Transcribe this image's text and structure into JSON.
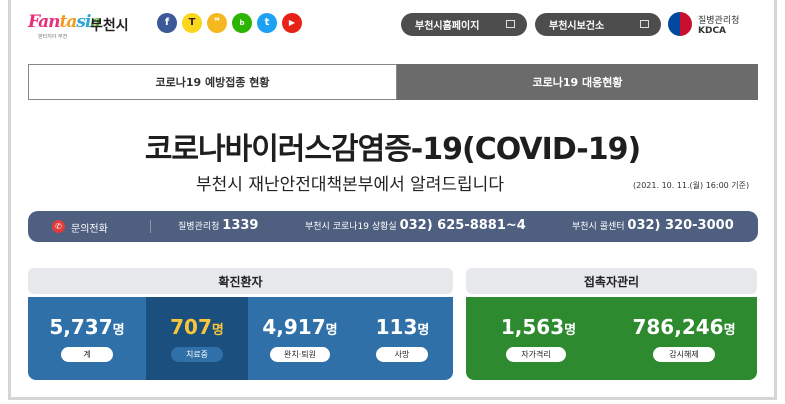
{
  "header": {
    "logo_text": "Fantasia",
    "logo_sub": "판타지아 부천",
    "city_name": "부천시",
    "sns_icons": [
      "facebook-icon",
      "kakaotalk-icon",
      "kakaostory-icon",
      "blog-icon",
      "twitter-icon",
      "youtube-icon"
    ],
    "buttons": {
      "homepage": "부천시홈페이지",
      "health_center": "부천시보건소"
    },
    "kdca": {
      "name_ko": "질병관리청",
      "name_en": "KDCA"
    }
  },
  "tabs": [
    {
      "label": "코로나19 예방접종 현황",
      "active": false
    },
    {
      "label": "코로나19 대응현황",
      "active": true
    }
  ],
  "title": "코로나바이러스감염증-19(COVID-19)",
  "subtitle": "부천시 재난안전대책본부에서 알려드립니다",
  "date": "(2021. 10. 11.(월) 16:00 기준)",
  "contact": {
    "label": "문의전화",
    "items": [
      {
        "name": "질병관리청",
        "number": "1339"
      },
      {
        "name": "부천시 코로나19 상황실",
        "number": "032) 625-8881~4"
      },
      {
        "name": "부천시 콜센터",
        "number": "032) 320-3000"
      }
    ]
  },
  "confirmed": {
    "heading": "확진환자",
    "unit": "명",
    "stats": [
      {
        "value": "5,737",
        "label": "계"
      },
      {
        "value": "707",
        "label": "치료중"
      },
      {
        "value": "4,917",
        "label": "완치·퇴원"
      },
      {
        "value": "113",
        "label": "사망"
      }
    ]
  },
  "contacts_mgmt": {
    "heading": "접촉자관리",
    "unit": "명",
    "stats": [
      {
        "value": "1,563",
        "label": "자가격리"
      },
      {
        "value": "786,246",
        "label": "감시해제"
      }
    ]
  },
  "colors": {
    "confirmed_panel": "#2f70a8",
    "highlight_cell": "#1b4f7d",
    "highlight_number": "#f8c53c",
    "contacts_panel": "#2e8a2e",
    "contact_bar": "#4e5f7f"
  }
}
